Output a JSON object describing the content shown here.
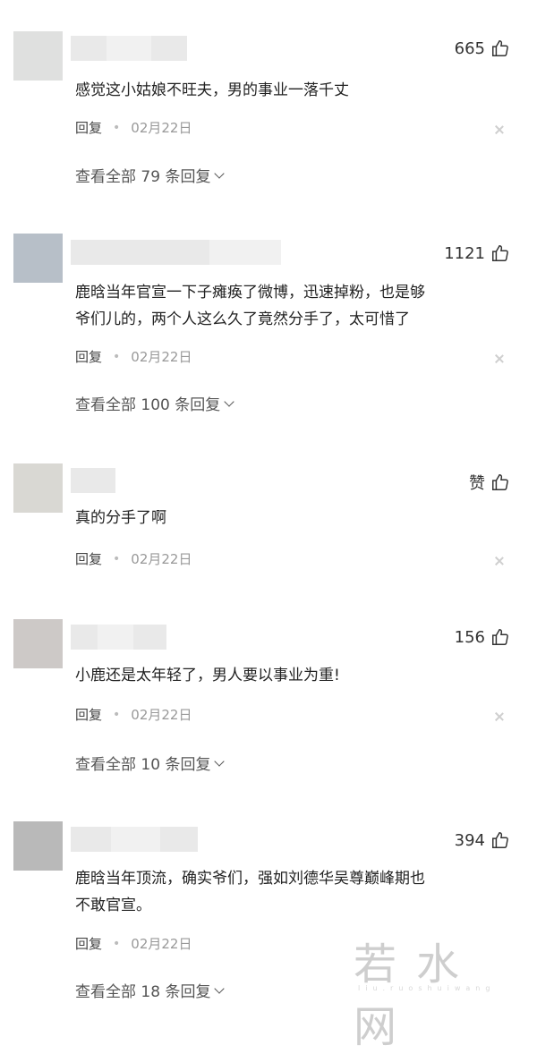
{
  "comments": [
    {
      "avatar_color": "#dfe0df",
      "likes": "665",
      "text_lines": [
        "感觉这小姑娘不旺夫，男的事业一落千丈"
      ],
      "reply_label": "回复",
      "date": "02月22日",
      "view_all": "查看全部 79 条回复"
    },
    {
      "avatar_color": "#b7bfc8",
      "likes": "1121",
      "text_lines": [
        "鹿晗当年官宣一下子瘫痪了微博，迅速掉粉，也是够",
        "爷们儿的，两个人这么久了竟然分手了，太可惜了"
      ],
      "reply_label": "回复",
      "date": "02月22日",
      "view_all": "查看全部 100 条回复"
    },
    {
      "avatar_color": "#d9d8d3",
      "likes": "赞",
      "text_lines": [
        "真的分手了啊"
      ],
      "reply_label": "回复",
      "date": "02月22日",
      "view_all": ""
    },
    {
      "avatar_color": "#cdc9c7",
      "likes": "156",
      "text_lines": [
        "小鹿还是太年轻了，男人要以事业为重!"
      ],
      "reply_label": "回复",
      "date": "02月22日",
      "view_all": "查看全部 10 条回复"
    },
    {
      "avatar_color": "#b9b9b9",
      "likes": "394",
      "text_lines": [
        "鹿晗当年顶流，确实爷们，强如刘德华吴尊巅峰期也",
        "不敢官宣。"
      ],
      "reply_label": "回复",
      "date": "02月22日",
      "view_all": "查看全部 18 条回复"
    }
  ],
  "watermark": "若水网",
  "watermark_sub": "liu.ruoshuiwang"
}
